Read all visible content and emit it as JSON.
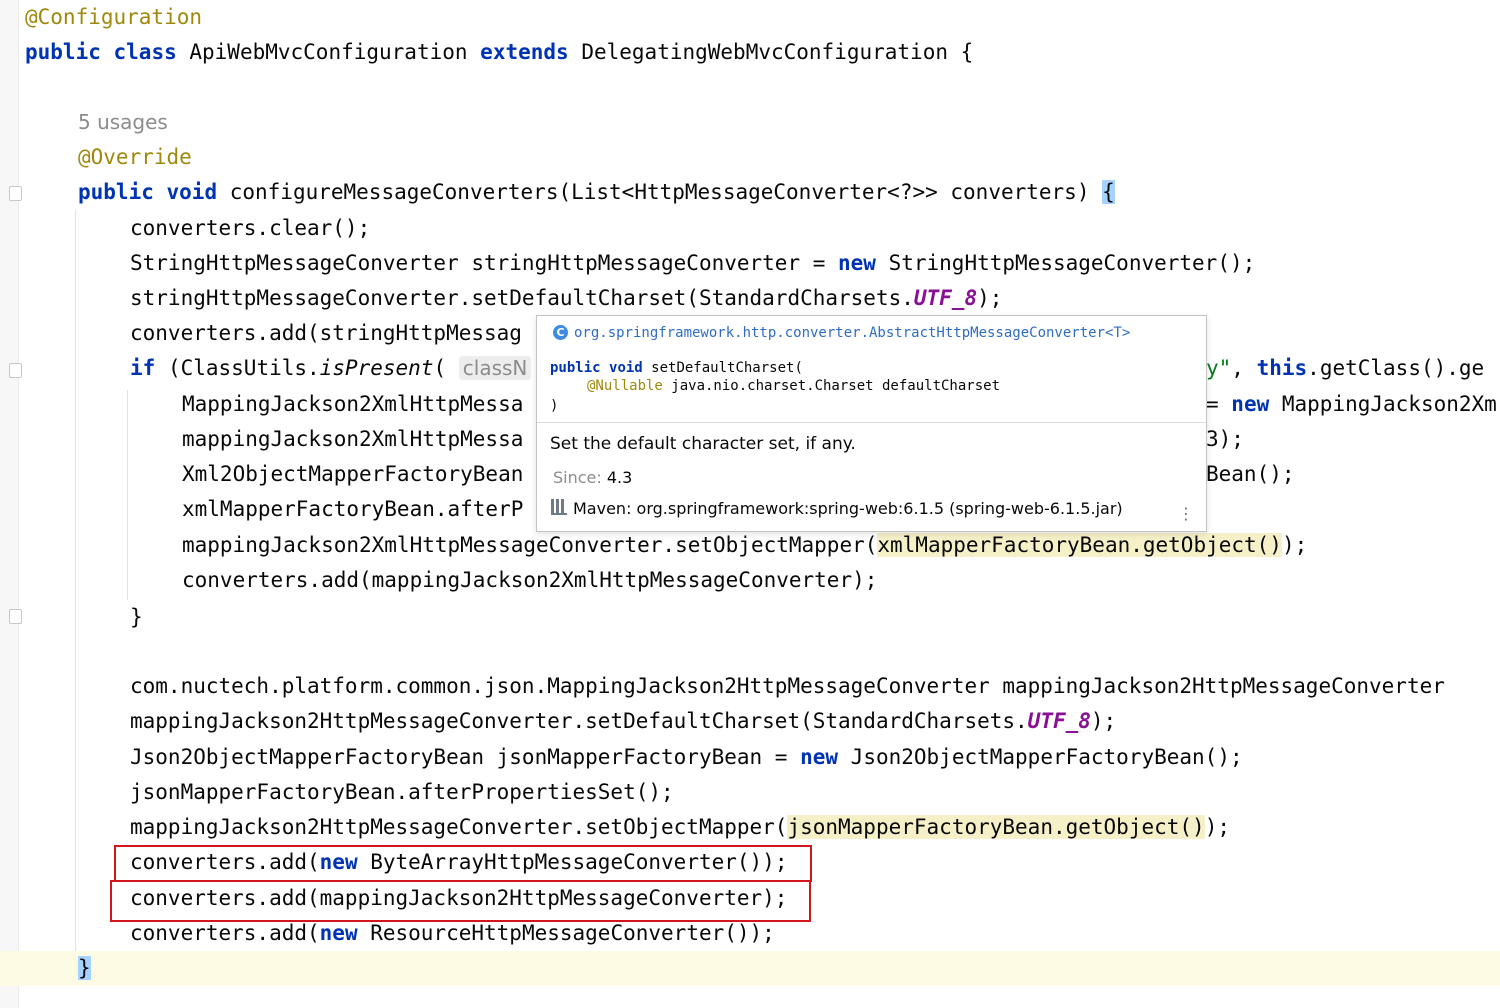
{
  "editor": {
    "annotation_config": "@Configuration",
    "class_decl": {
      "kw1": "public",
      "kw2": "class",
      "name": " ApiWebMvcConfiguration ",
      "kw3": "extends",
      "rest": " DelegatingWebMvcConfiguration {"
    },
    "usages_hint": "5 usages",
    "annotation_override": "@Override",
    "method_decl": {
      "kw1": "public",
      "kw2": "void",
      "rest": " configureMessageConverters(List<HttpMessageConverter<?>> converters) ",
      "brace": "{"
    },
    "l1": "converters.clear();",
    "l2a": "StringHttpMessageConverter stringHttpMessageConverter = ",
    "l2kw": "new",
    "l2b": " StringHttpMessageConverter();",
    "l3a": "stringHttpMessageConverter.setDefaultCharset(StandardCharsets.",
    "l3c": "UTF_8",
    "l3b": ");",
    "l4": "converters.add(stringHttpMessag",
    "l5kw": "if",
    "l5a": " (ClassUtils.",
    "l5i": "isPresent",
    "l5b": "( ",
    "l5hint": "classN",
    "l5str": "y\"",
    "l5c": ", ",
    "l5kw2": "this",
    "l5d": ".getClass().ge",
    "l6a": "MappingJackson2XmlHttpMessa",
    "l6b": "= ",
    "l6kw": "new",
    "l6c": " MappingJackson2Xm",
    "l7a": "mappingJackson2XmlHttpMessa",
    "l7b": "3);",
    "l8a": "Xml2ObjectMapperFactoryBean",
    "l8b": "Bean();",
    "l9a": "xmlMapperFactoryBean.afterP",
    "l10a": "mappingJackson2XmlHttpMessageConverter.setObjectMapper(",
    "l10h": "xmlMapperFactoryBean.getObject()",
    "l10b": ");",
    "l11": "converters.add(mappingJackson2XmlHttpMessageConverter);",
    "l12": "}",
    "l13": "com.nuctech.platform.common.json.MappingJackson2HttpMessageConverter mappingJackson2HttpMessageConverter",
    "l14a": "mappingJackson2HttpMessageConverter.setDefaultCharset(StandardCharsets.",
    "l14c": "UTF_8",
    "l14b": ");",
    "l15a": "Json2ObjectMapperFactoryBean jsonMapperFactoryBean = ",
    "l15kw": "new",
    "l15b": " Json2ObjectMapperFactoryBean();",
    "l16": "jsonMapperFactoryBean.afterPropertiesSet();",
    "l17a": "mappingJackson2HttpMessageConverter.setObjectMapper(",
    "l17h": "jsonMapperFactoryBean.getObject()",
    "l17b": ");",
    "l18a": "converters.add(",
    "l18kw": "new",
    "l18b": " ByteArrayHttpMessageConverter());",
    "l19": "converters.add(mappingJackson2HttpMessageConverter);",
    "l20a": "converters.add(",
    "l20kw": "new",
    "l20b": " ResourceHttpMessageConverter());",
    "close_brace": "}"
  },
  "popup": {
    "class_icon": "C",
    "package": "org.springframework.http.converter.AbstractHttpMessageConverter<T>",
    "sig_kw1": "public",
    "sig_kw2": "void",
    "sig_name": " setDefaultCharset(",
    "sig_ann": "@Nullable",
    "sig_param": " java.nio.charset.Charset defaultCharset",
    "sig_close": ")",
    "description": "Set the default character set, if any.",
    "since_label": "Since:",
    "since_value": "4.3",
    "maven": "Maven: org.springframework:spring-web:6.1.5 (spring-web-6.1.5.jar)",
    "more_icon": "⋮"
  },
  "colors": {
    "keyword": "#0033b3",
    "annotation": "#9e880d",
    "constant": "#871094",
    "highlight_box": "#d3161b",
    "caret_row": "#fefbe4"
  }
}
